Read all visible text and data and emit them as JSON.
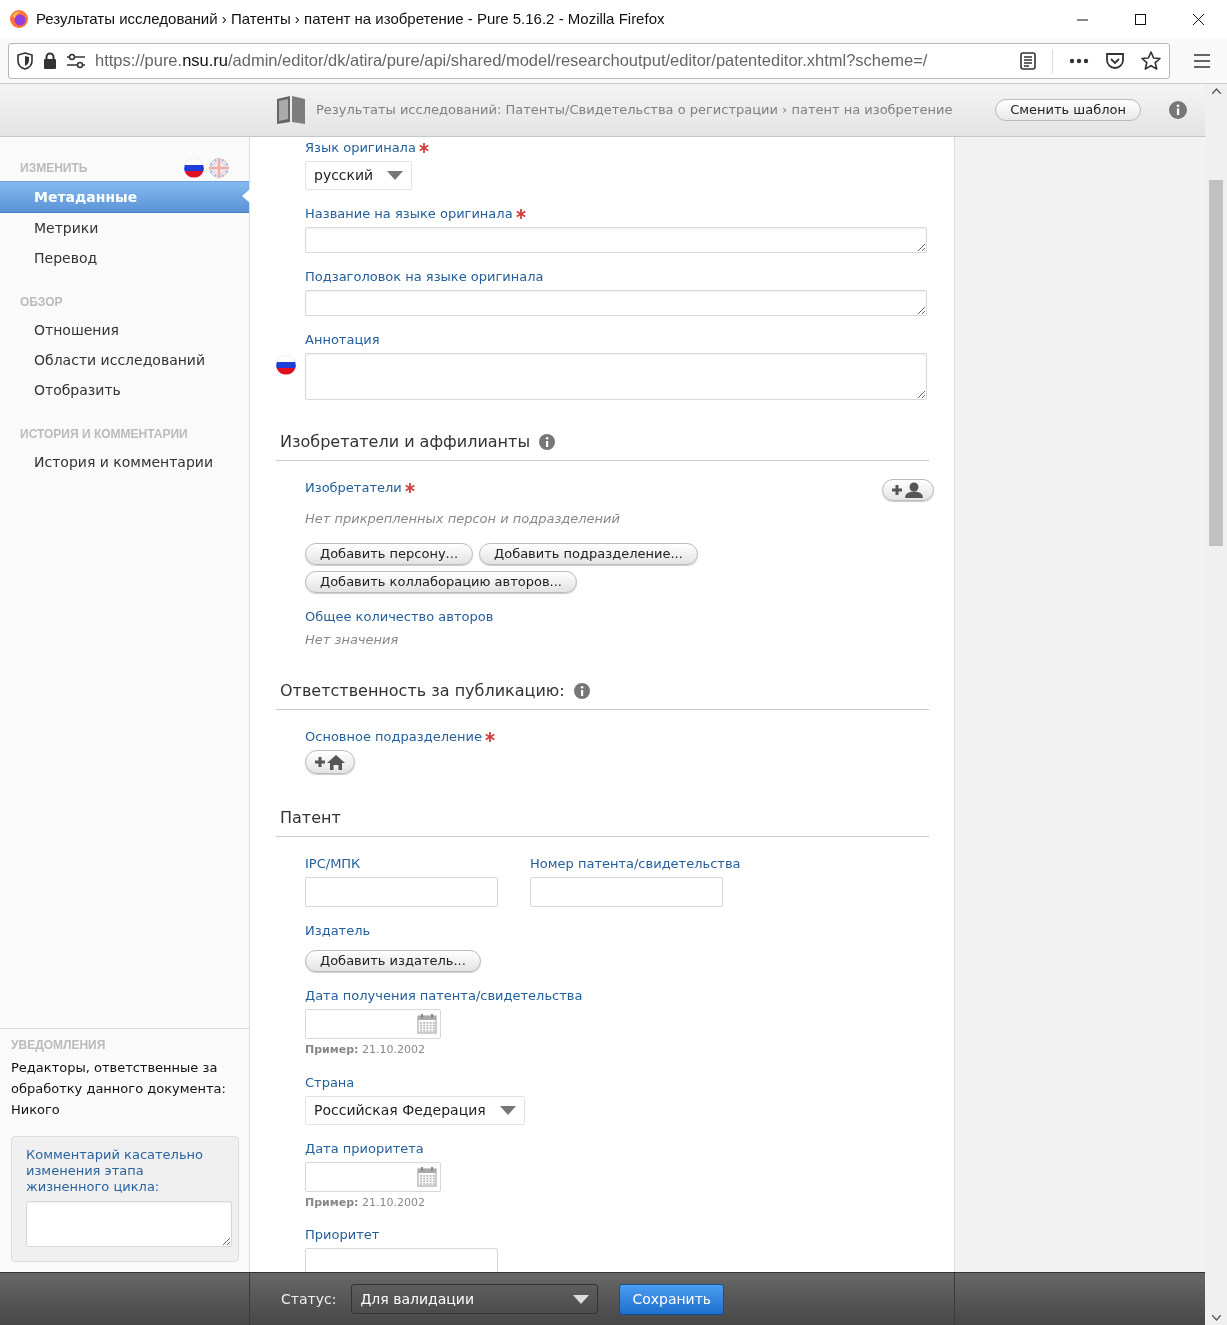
{
  "window": {
    "title": "Результаты исследований › Патенты › патент на изобретение - Pure 5.16.2 - Mozilla Firefox",
    "url_start": "https://pure.",
    "url_host": "nsu.ru",
    "url_end": "/admin/editor/dk/atira/pure/api/shared/model/researchoutput/editor/patenteditor.xhtml?scheme=/"
  },
  "header": {
    "breadcrumb": "Результаты исследований: Патенты/Свидетельства о регистрации › патент на изобретение",
    "template_button": "Сменить шаблон"
  },
  "sidebar": {
    "sections": [
      {
        "heading": "ИЗМЕНИТЬ",
        "language_flags": true,
        "items": [
          {
            "label": "Метаданные",
            "selected": true
          },
          {
            "label": "Метрики",
            "selected": false
          },
          {
            "label": "Перевод",
            "selected": false
          }
        ]
      },
      {
        "heading": "ОБЗОР",
        "language_flags": false,
        "items": [
          {
            "label": "Отношения",
            "selected": false
          },
          {
            "label": "Области исследований",
            "selected": false
          },
          {
            "label": "Отобразить",
            "selected": false
          }
        ]
      },
      {
        "heading": "ИСТОРИЯ И КОММЕНТАРИИ",
        "language_flags": false,
        "items": [
          {
            "label": "История и комментарии",
            "selected": false
          }
        ]
      }
    ],
    "notifications": {
      "heading": "УВЕДОМЛЕНИЯ",
      "text": "Редакторы, ответственные за обработку данного документа:",
      "value": "Никого",
      "comment_label": "Комментарий касательно изменения этапа жизненного цикла:"
    }
  },
  "form": {
    "fields": [
      {
        "kind": "select",
        "label": "Язык оригинала",
        "required": true,
        "value": "русский"
      },
      {
        "kind": "textarea",
        "label": "Название на языке оригинала",
        "required": true,
        "flag": false
      },
      {
        "kind": "textarea",
        "label": "Подзаголовок на языке оригинала",
        "required": false,
        "flag": false
      },
      {
        "kind": "textarea_tall",
        "label": "Аннотация",
        "required": false,
        "flag": true
      }
    ],
    "sections": [
      {
        "title": "Изобретатели и аффилианты",
        "info": true,
        "fields": [
          {
            "kind": "persons",
            "label": "Изобретатели",
            "required": true,
            "empty_text": "Нет прикрепленных персон и подразделений",
            "buttons": [
              "Добавить персону...",
              "Добавить подразделение...",
              "Добавить коллаборацию авторов..."
            ]
          },
          {
            "kind": "value",
            "label": "Общее количество авторов",
            "required": false,
            "empty_text": "Нет значения"
          }
        ]
      },
      {
        "title": "Ответственность за публикацию:",
        "info": true,
        "fields": [
          {
            "kind": "org",
            "label": "Основное подразделение",
            "required": true
          }
        ]
      },
      {
        "title": "Патент",
        "info": false,
        "fields": [
          {
            "kind": "pair",
            "items": [
              {
                "label": "IPC/МПК"
              },
              {
                "label": "Номер патента/свидетельства"
              }
            ]
          },
          {
            "kind": "button",
            "label": "Издатель",
            "required": false,
            "button": "Добавить издатель..."
          },
          {
            "kind": "date",
            "label": "Дата получения патента/свидетельства",
            "required": false,
            "hint": "**Пример:** 21.10.2002"
          },
          {
            "kind": "select",
            "label": "Страна",
            "required": false,
            "value": "Российская Федерация"
          },
          {
            "kind": "date",
            "label": "Дата приоритета",
            "required": false,
            "hint": "**Пример:** 21.10.2002"
          },
          {
            "kind": "input",
            "label": "Приоритет",
            "required": false
          }
        ]
      }
    ]
  },
  "status_bar": {
    "label": "Статус:",
    "value": "Для валидации",
    "save_button": "Сохранить"
  }
}
